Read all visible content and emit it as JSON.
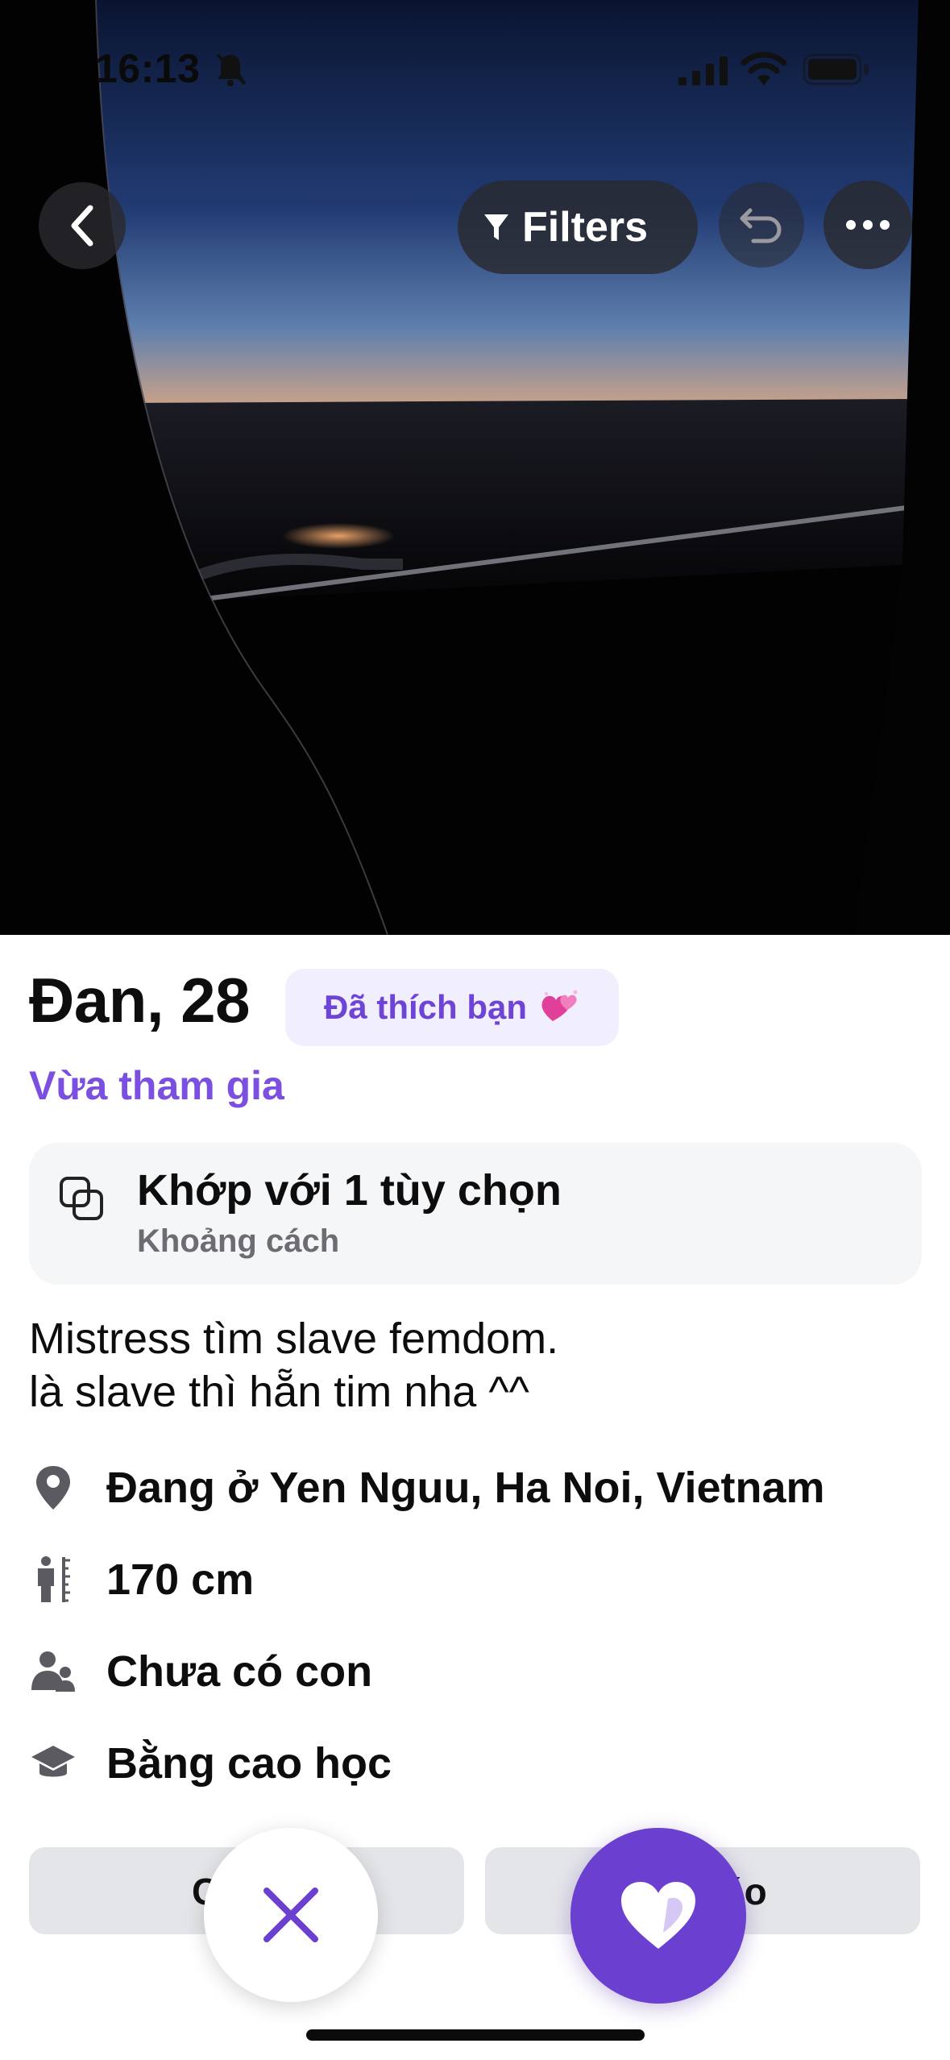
{
  "status_bar": {
    "time": "16:13"
  },
  "top_bar": {
    "filters_label": "Filters"
  },
  "profile": {
    "name_age": "Đan, 28",
    "liked_badge": "Đã thích bạn",
    "joined": "Vừa tham gia",
    "match": {
      "title": "Khớp với 1 tùy chọn",
      "subtitle": "Khoảng cách"
    },
    "bio_lines": [
      "Mistress tìm slave femdom.",
      "là slave thì hẵn tim nha ^^"
    ],
    "details": [
      {
        "icon": "location-pin-icon",
        "text": "Đang ở Yen Nguu, Ha Noi, Vietnam"
      },
      {
        "icon": "height-icon",
        "text": "170 cm"
      },
      {
        "icon": "children-icon",
        "text": "Chưa có con"
      },
      {
        "icon": "education-cap-icon",
        "text": "Bằng cao học"
      }
    ]
  },
  "bottom_bar": {
    "left_partial_label": "C",
    "right_partial_label": "áo"
  },
  "colors": {
    "accent": "#6b3fcf",
    "accent_text": "#7b4fdf",
    "badge_bg": "#f1eefd",
    "card_bg": "#f5f6f8",
    "button_bg": "#e4e5e9"
  }
}
